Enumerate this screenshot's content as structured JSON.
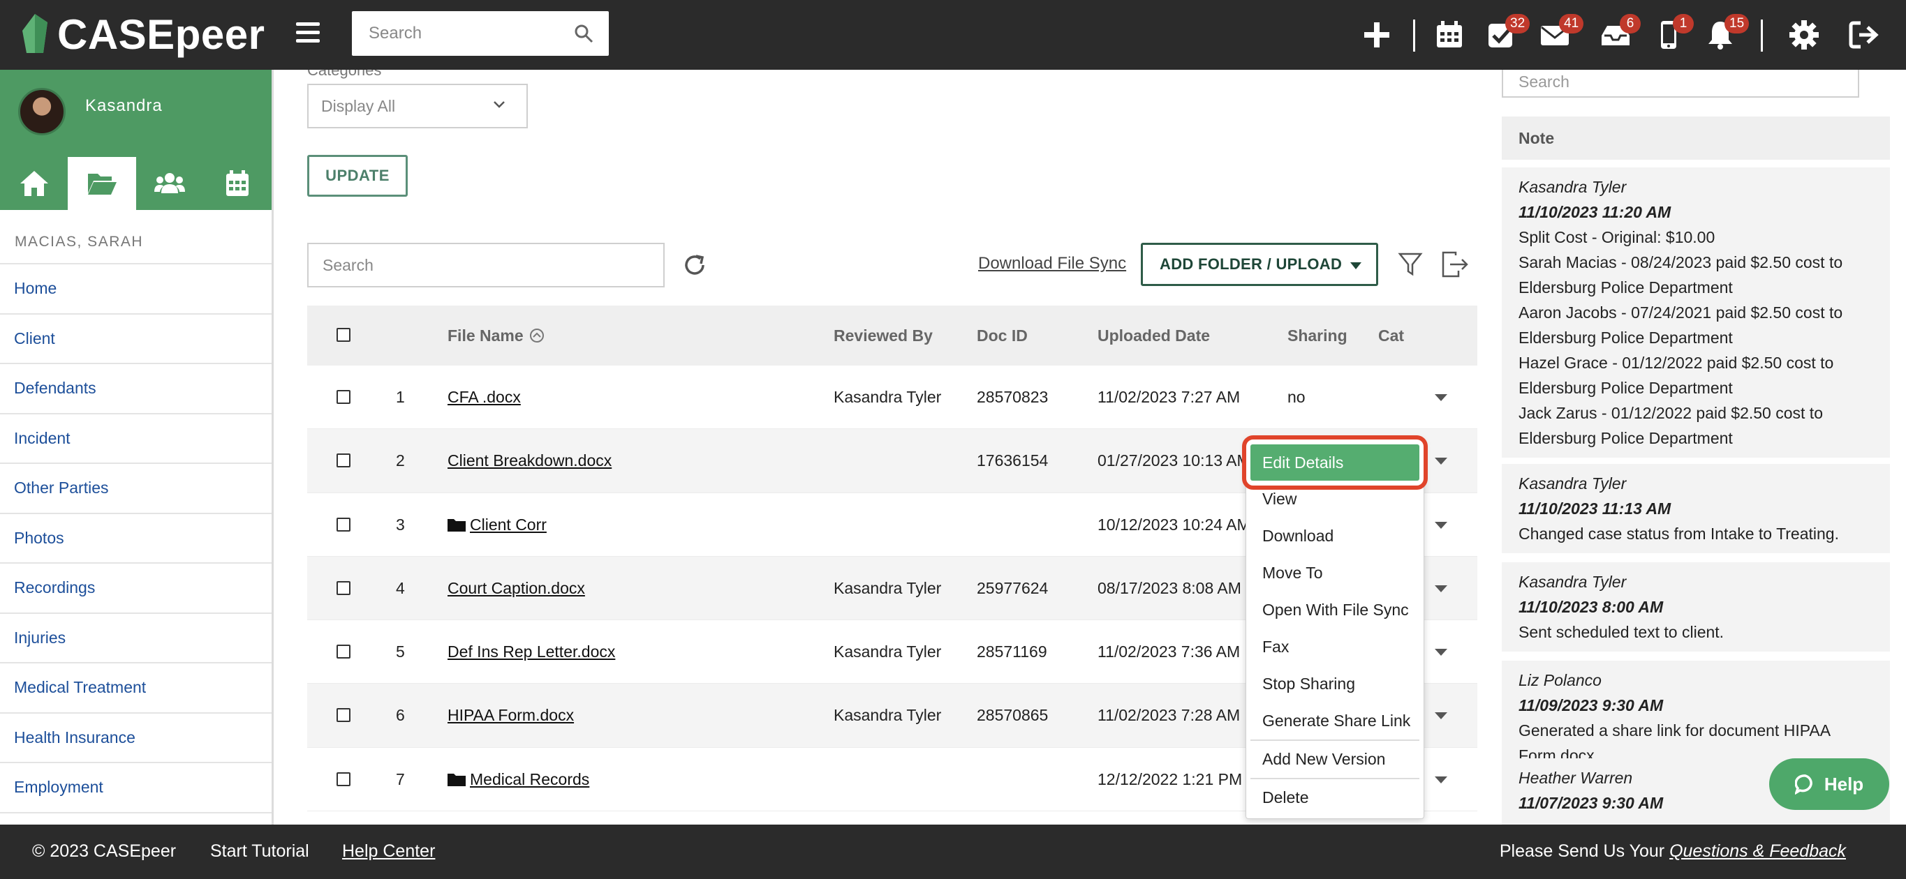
{
  "app": {
    "brand": "CASEpeer",
    "accent": "#4e9a63",
    "search_placeholder": "Search"
  },
  "topbar": {
    "icons": [
      {
        "name": "plus-icon",
        "badge": ""
      },
      {
        "name": "calendar-icon",
        "badge": ""
      },
      {
        "name": "tasks-icon",
        "badge": "32"
      },
      {
        "name": "mail-icon",
        "badge": "41"
      },
      {
        "name": "inbox-icon",
        "badge": "6"
      },
      {
        "name": "phone-icon",
        "badge": "1"
      },
      {
        "name": "bell-icon",
        "badge": "15"
      },
      {
        "name": "gear-icon",
        "badge": ""
      },
      {
        "name": "logout-icon",
        "badge": ""
      }
    ]
  },
  "sidebar": {
    "user_name": "Kasandra",
    "case_name": "MACIAS, SARAH",
    "nav_tabs": [
      "home-icon",
      "folder-open-icon",
      "users-icon",
      "calendar-icon"
    ],
    "items": [
      "Home",
      "Client",
      "Defendants",
      "Incident",
      "Other Parties",
      "Photos",
      "Recordings",
      "Injuries",
      "Medical Treatment",
      "Health Insurance",
      "Employment"
    ]
  },
  "main": {
    "category_label": "Categories",
    "category_value": "Display All",
    "update_label": "UPDATE",
    "search_placeholder": "Search",
    "download_sync_label": "Download File Sync",
    "add_folder_label": "ADD FOLDER / UPLOAD",
    "columns": {
      "file_name": "File Name",
      "reviewed_by": "Reviewed By",
      "doc_id": "Doc ID",
      "uploaded_date": "Uploaded Date",
      "sharing": "Sharing",
      "category": "Cat"
    },
    "rows": [
      {
        "num": "1",
        "name": "CFA .docx",
        "folder": false,
        "reviewed_by": "Kasandra Tyler",
        "doc_id": "28570823",
        "uploaded": "11/02/2023 7:27 AM",
        "sharing": "no"
      },
      {
        "num": "2",
        "name": "Client Breakdown.docx",
        "folder": false,
        "reviewed_by": "",
        "doc_id": "17636154",
        "uploaded": "01/27/2023 10:13 AM",
        "sharing": ""
      },
      {
        "num": "3",
        "name": "Client Corr",
        "folder": true,
        "reviewed_by": "",
        "doc_id": "",
        "uploaded": "10/12/2023 10:24 AM",
        "sharing": ""
      },
      {
        "num": "4",
        "name": "Court Caption.docx",
        "folder": false,
        "reviewed_by": "Kasandra Tyler",
        "doc_id": "25977624",
        "uploaded": "08/17/2023 8:08 AM",
        "sharing": ""
      },
      {
        "num": "5",
        "name": "Def Ins Rep Letter.docx",
        "folder": false,
        "reviewed_by": "Kasandra Tyler",
        "doc_id": "28571169",
        "uploaded": "11/02/2023 7:36 AM",
        "sharing": ""
      },
      {
        "num": "6",
        "name": "HIPAA Form.docx",
        "folder": false,
        "reviewed_by": "Kasandra Tyler",
        "doc_id": "28570865",
        "uploaded": "11/02/2023 7:28 AM",
        "sharing": ""
      },
      {
        "num": "7",
        "name": "Medical Records",
        "folder": true,
        "reviewed_by": "",
        "doc_id": "",
        "uploaded": "12/12/2022 1:21 PM",
        "sharing": ""
      }
    ],
    "context_menu": [
      "Edit Details",
      "View",
      "Download",
      "Move To",
      "Open With File Sync",
      "Fax",
      "Stop Sharing",
      "Generate Share Link",
      "Add New Version",
      "Delete"
    ]
  },
  "notes": {
    "search_placeholder": "Search",
    "header": "Note",
    "entries": [
      {
        "author": "Kasandra Tyler",
        "time": "11/10/2023 11:20 AM",
        "lines": [
          "Split Cost - Original: $10.00",
          "Sarah Macias - 08/24/2023 paid $2.50 cost to",
          "Eldersburg Police Department",
          "Aaron Jacobs - 07/24/2021 paid $2.50 cost to",
          "Eldersburg Police Department",
          "Hazel Grace - 01/12/2022 paid $2.50 cost to",
          "Eldersburg Police Department",
          "Jack Zarus - 01/12/2022 paid $2.50 cost to",
          "Eldersburg Police Department"
        ]
      },
      {
        "author": "Kasandra Tyler",
        "time": "11/10/2023 11:13 AM",
        "lines": [
          "Changed case status from Intake to Treating."
        ]
      },
      {
        "author": "Kasandra Tyler",
        "time": "11/10/2023 8:00 AM",
        "lines": [
          "Sent scheduled text to client."
        ]
      },
      {
        "author": "Liz Polanco",
        "time": "11/09/2023 9:30 AM",
        "lines": [
          "Generated a share link for document HIPAA",
          "Form.docx"
        ]
      },
      {
        "author": "Heather Warren",
        "time": "11/07/2023 9:30 AM",
        "lines": []
      }
    ],
    "help_label": "Help"
  },
  "footer": {
    "copyright": "© 2023 CASEpeer",
    "tutorial": "Start Tutorial",
    "help_center": "Help Center",
    "feedback_prefix": "Please Send Us Your ",
    "feedback_link": "Questions & Feedback"
  }
}
